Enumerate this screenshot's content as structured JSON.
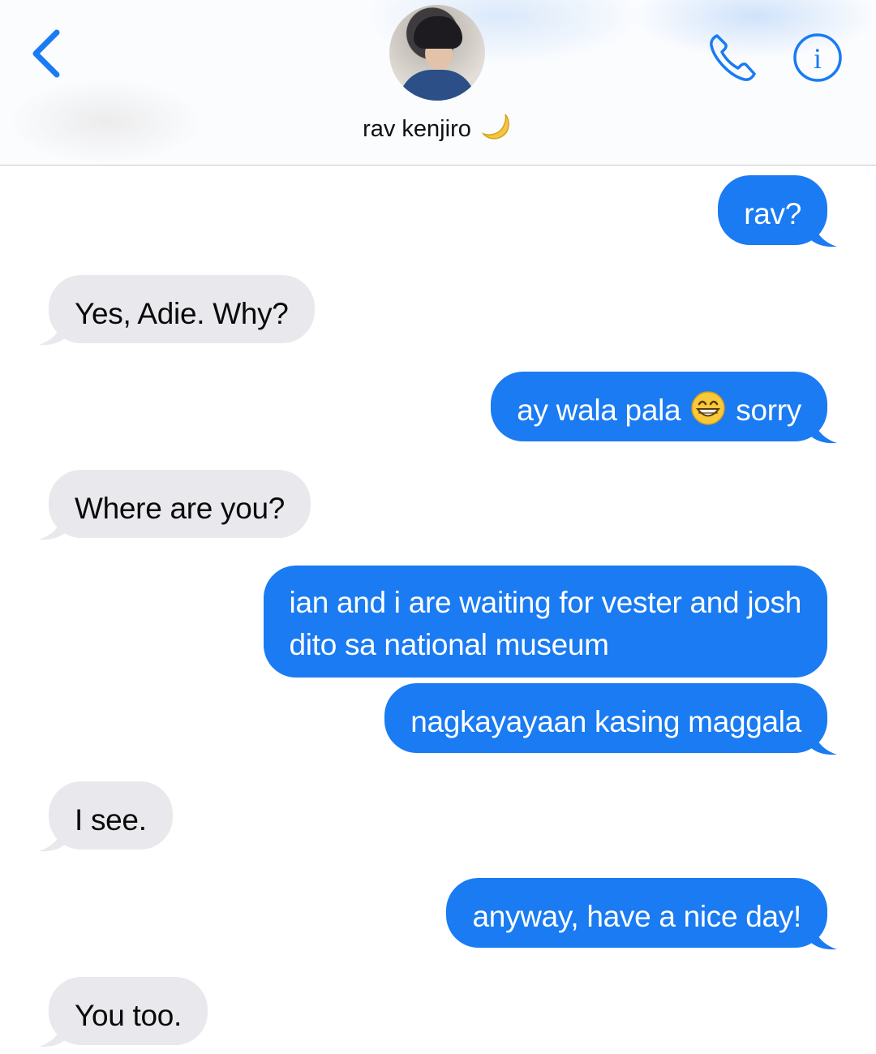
{
  "header": {
    "contact_name": "rav kenjiro",
    "contact_emoji_icon": "crescent-moon-icon",
    "back_icon": "chevron-left-icon",
    "call_icon": "phone-icon",
    "info_icon": "info-icon",
    "info_glyph": "i"
  },
  "colors": {
    "accent": "#1a7bf2",
    "sent_bubble": "#1a7bf2",
    "received_bubble": "#e9e9ed"
  },
  "messages": [
    {
      "direction": "sent",
      "text": "rav?"
    },
    {
      "direction": "received",
      "text": "Yes, Adie. Why?"
    },
    {
      "direction": "sent",
      "text_before_emoji": "ay wala pala",
      "emoji_icon": "grinning-face-icon",
      "text_after_emoji": "sorry"
    },
    {
      "direction": "received",
      "text": "Where are you?"
    },
    {
      "direction": "sent",
      "line1": "ian and i are waiting for vester and josh",
      "line2": "dito sa national museum"
    },
    {
      "direction": "sent",
      "text": "nagkayayaan kasing maggala"
    },
    {
      "direction": "received",
      "text": "I see."
    },
    {
      "direction": "sent",
      "text": "anyway, have a nice day!"
    },
    {
      "direction": "received",
      "text": "You too."
    }
  ]
}
